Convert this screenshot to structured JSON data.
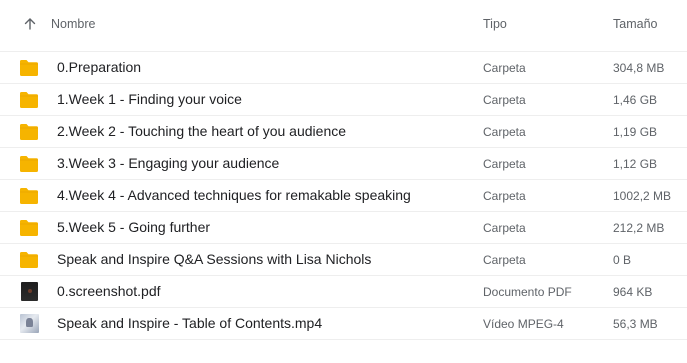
{
  "header": {
    "sort_icon": "arrow-up-icon",
    "name_label": "Nombre",
    "type_label": "Tipo",
    "size_label": "Tamaño"
  },
  "colors": {
    "folder": "#F6B400",
    "folder_tab": "#E8A400",
    "divider": "#EEEEEE"
  },
  "rows": [
    {
      "icon": "folder-icon",
      "name": "0.Preparation",
      "type": "Carpeta",
      "size": "304,8 MB"
    },
    {
      "icon": "folder-icon",
      "name": "1.Week 1 - Finding your voice",
      "type": "Carpeta",
      "size": "1,46 GB"
    },
    {
      "icon": "folder-icon",
      "name": "2.Week 2 - Touching the heart of you audience",
      "type": "Carpeta",
      "size": "1,19 GB"
    },
    {
      "icon": "folder-icon",
      "name": "3.Week 3 - Engaging your audience",
      "type": "Carpeta",
      "size": "1,12 GB"
    },
    {
      "icon": "folder-icon",
      "name": "4.Week 4 - Advanced techniques for remakable speaking",
      "type": "Carpeta",
      "size": "1002,2 MB"
    },
    {
      "icon": "folder-icon",
      "name": "5.Week 5 - Going further",
      "type": "Carpeta",
      "size": "212,2 MB"
    },
    {
      "icon": "folder-icon",
      "name": "Speak and Inspire Q&A Sessions with Lisa Nichols",
      "type": "Carpeta",
      "size": "0 B"
    },
    {
      "icon": "pdf-thumbnail-icon",
      "name": "0.screenshot.pdf",
      "type": "Documento PDF",
      "size": "964 KB"
    },
    {
      "icon": "video-thumbnail-icon",
      "name": "Speak and Inspire - Table of Contents.mp4",
      "type": "Vídeo MPEG-4",
      "size": "56,3 MB"
    }
  ]
}
